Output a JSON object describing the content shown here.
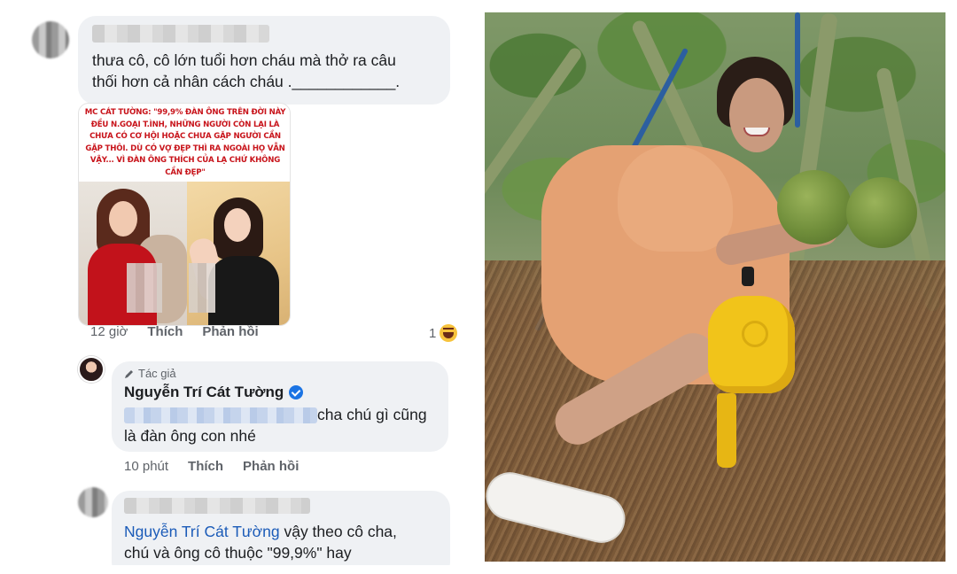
{
  "left_panel": {
    "comment1": {
      "line1": "thưa cô, cô lớn tuổi hơn cháu mà thở ra câu",
      "line2": "thối hơn cả nhân cách cháu .____________.",
      "meme_text": "MC CÁT TƯỜNG: \"99,9% ĐÀN ÔNG TRÊN ĐỜI NÀY ĐỀU N.GOẠI T.ÌNH, NHỮNG NGƯỜI CÒN LẠI LÀ CHƯA CÓ CƠ HỘI HOẶC CHƯA GẶP NGƯỜI CẦN GẶP THÔI. DÙ CÓ VỢ ĐẸP THÌ RA NGOÀI HỌ VẪN VẬY... VÌ ĐÀN ÔNG THÍCH CỦA LẠ CHỨ KHÔNG CẦN ĐẸP\"",
      "time": "12 giờ",
      "like": "Thích",
      "reply": "Phản hồi",
      "reaction_count": "1"
    },
    "comment2": {
      "author_tag": "Tác giả",
      "author_name": "Nguyễn Trí Cát Tường",
      "line1": "cha chú gì cũng",
      "line2": "là đàn ông con nhé",
      "time": "10 phút",
      "like": "Thích",
      "reply": "Phản hồi"
    },
    "comment3": {
      "mention": "Nguyễn Trí Cát Tường",
      "line1_rest": " vậy theo cô cha,",
      "line2": "chú và ông cô thuộc \"99,9%\" hay"
    }
  },
  "colors": {
    "bubble": "#eff1f4",
    "facebook_blue": "#1b74e4",
    "meme_red": "#c8141b",
    "dress": "#e4a173",
    "bag": "#f1c41a"
  }
}
